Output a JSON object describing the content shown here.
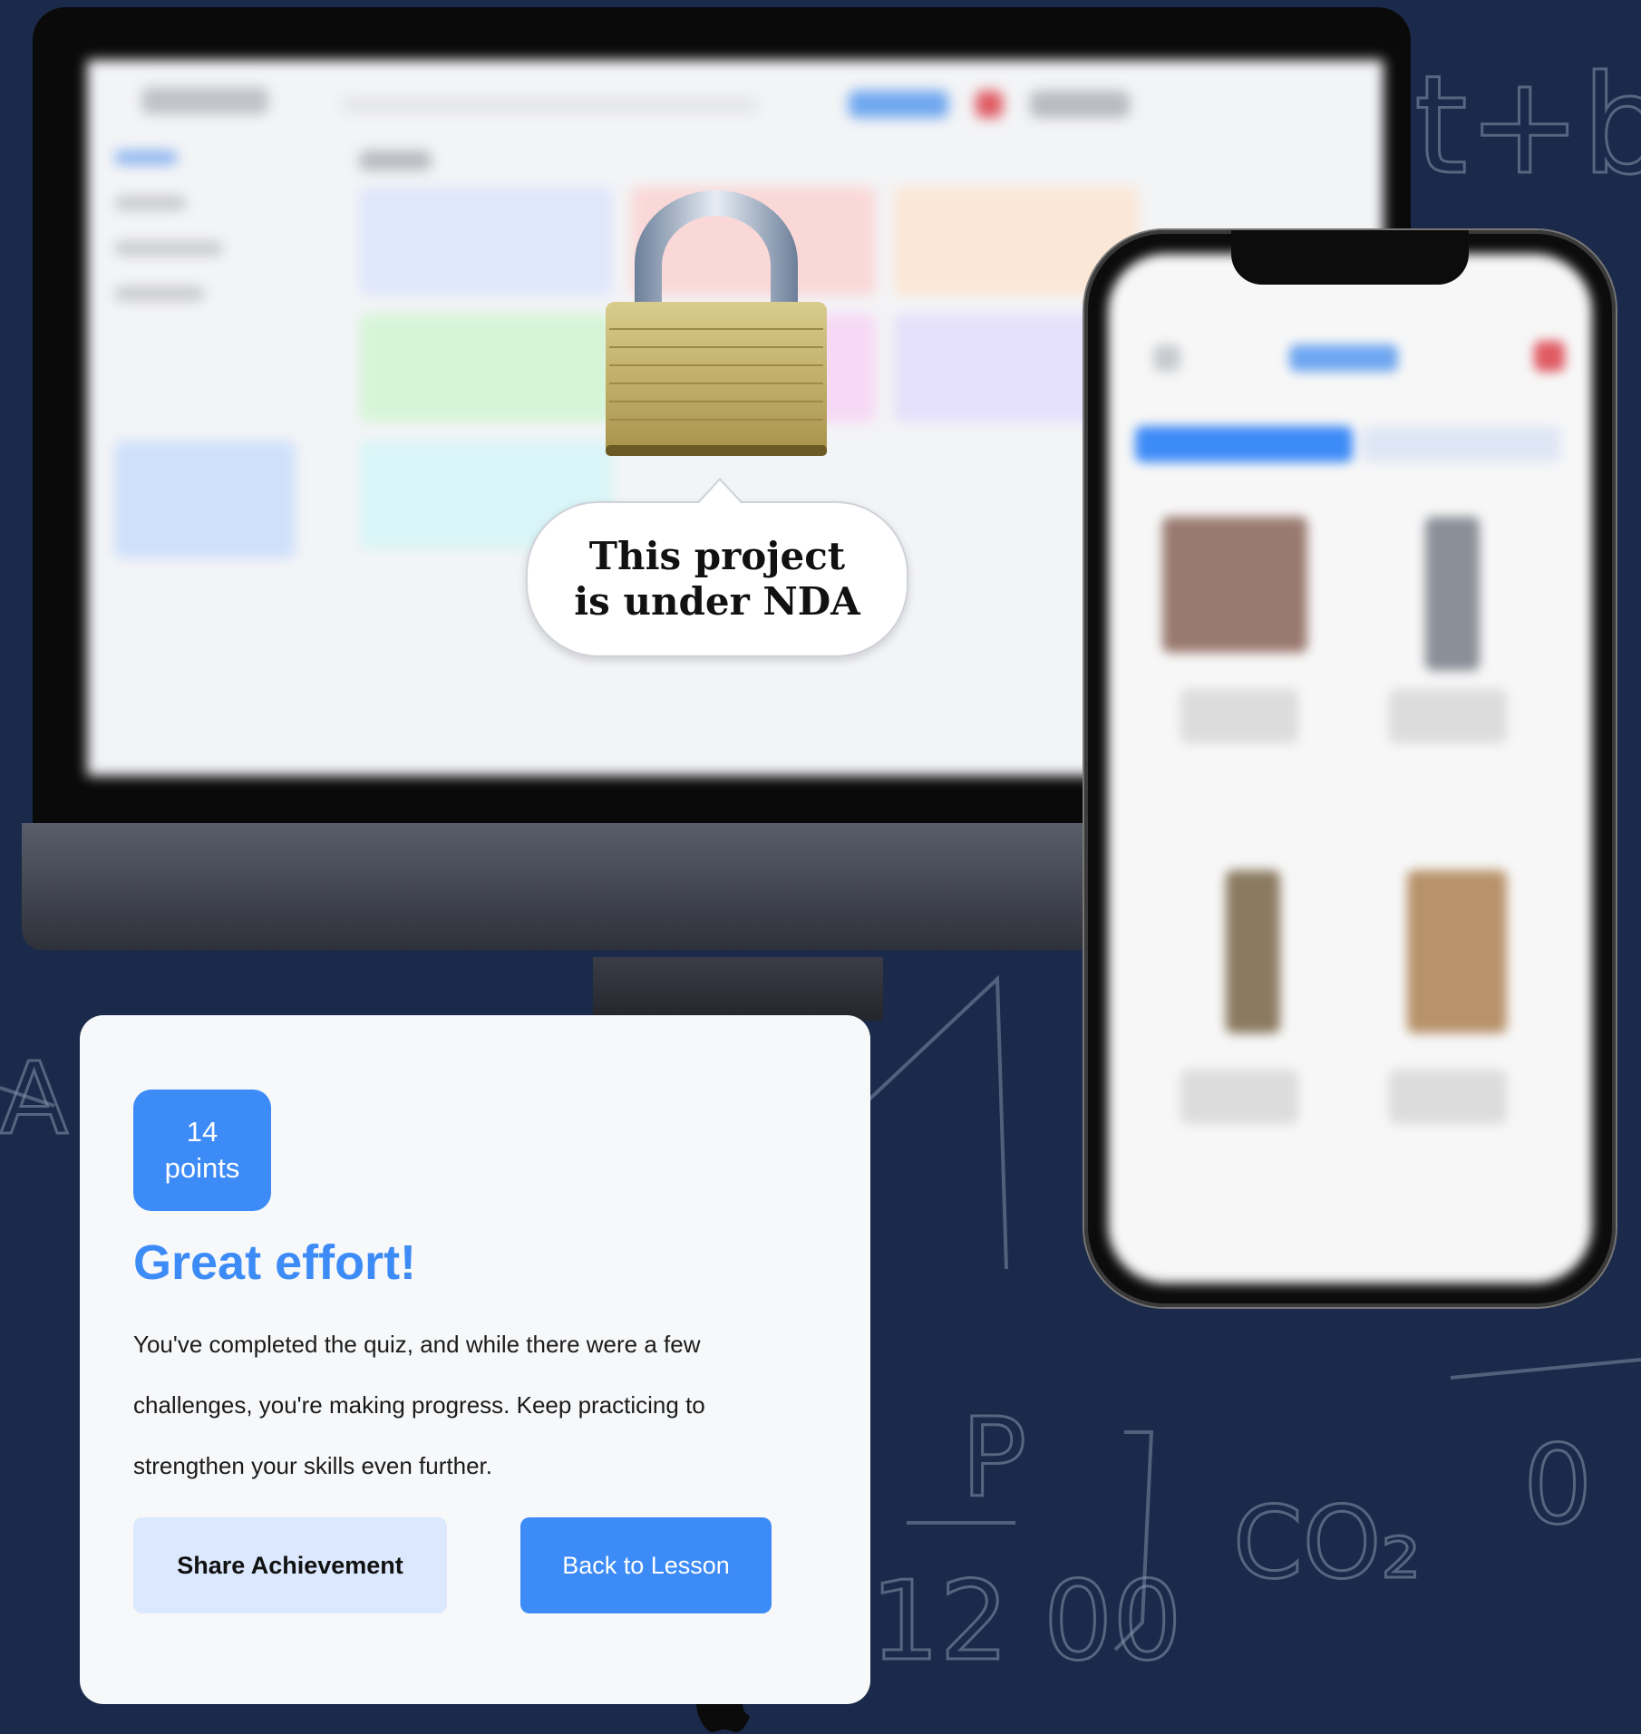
{
  "nda": {
    "message": "This project is under NDA"
  },
  "card": {
    "points_value": "14",
    "points_label": "points",
    "title": "Great effort!",
    "description": "You've completed the quiz, and while there were a few challenges, you're making progress. Keep practicing to strengthen your skills even further.",
    "share_label": "Share Achievement",
    "back_label": "Back to Lesson"
  },
  "icons": [
    "lock-icon",
    "apple-logo-icon"
  ],
  "colors": {
    "accent": "#3d8bf7",
    "accent_light": "#dbe8fd",
    "background": "#1b2a4a"
  }
}
